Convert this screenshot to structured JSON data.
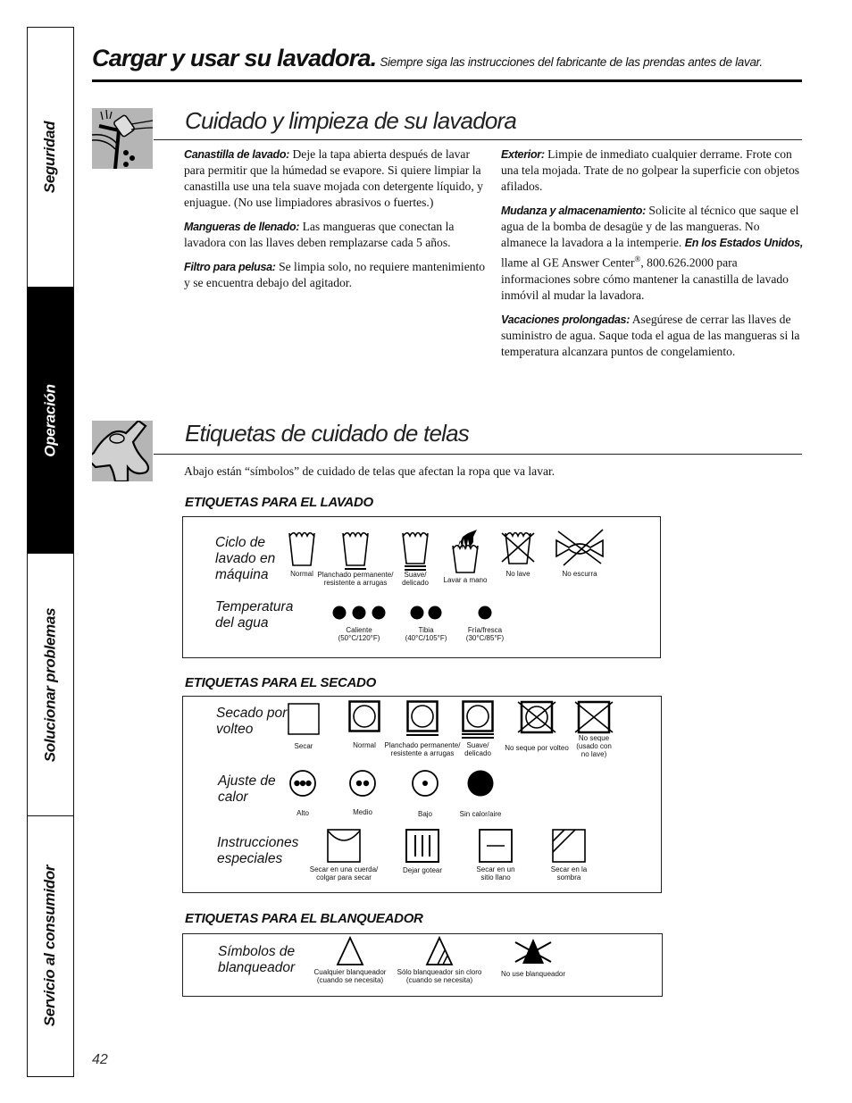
{
  "side_tabs": [
    {
      "label": "Seguridad",
      "active": false
    },
    {
      "label": "Operación",
      "active": true
    },
    {
      "label": "Solucionar problemas",
      "active": false
    },
    {
      "label": "Servicio al consumidor",
      "active": false
    }
  ],
  "header": {
    "title": "Cargar y usar su lavadora.",
    "subtitle": "Siempre siga las instrucciones del fabricante de las prendas antes de lavar."
  },
  "care_section": {
    "icon": "washer-cleaning-sponge-icon",
    "title": "Cuidado y limpieza de su lavadora",
    "left": [
      {
        "term": "Canastilla de lavado:",
        "text": "Deje la tapa abierta después de lavar para permitir que la húmedad se evapore. Si quiere limpiar la canastilla use una tela suave mojada con detergente líquido, y enjuague. (No use limpiadores abrasivos o fuertes.)"
      },
      {
        "term": "Mangueras de llenado:",
        "text": "Las mangueras que conectan la lavadora con las llaves deben remplazarse cada 5 años."
      },
      {
        "term": "Filtro para pelusa:",
        "text": "Se limpia solo, no requiere mantenimiento y se encuentra debajo del agitador."
      }
    ],
    "right": [
      {
        "term": "Exterior:",
        "text": "Limpie de inmediato cualquier derrame. Frote con una tela mojada. Trate de no golpear la superficie con objetos afilados."
      },
      {
        "term": "Mudanza y almacenamiento:",
        "text": "Solicite al técnico que saque el agua de la bomba de desagüe y de las mangueras. No almanece la lavadora a la intemperie.",
        "term2": "En los Estados Unidos,",
        "text2": "llame al GE Answer Center",
        "reg": "®",
        "text3": ", 800.626.2000 para informaciones sobre cómo mantener la canastilla de lavado inmóvil al mudar la lavadora."
      },
      {
        "term": "Vacaciones prolongadas:",
        "text": "Asegúrese de cerrar las llaves de suministro de agua. Saque toda el agua de las mangueras si la temperatura alcanzara puntos de congelamiento."
      }
    ]
  },
  "fabric_section": {
    "icon": "shirt-icon",
    "title": "Etiquetas de cuidado de telas",
    "intro": "Abajo están “símbolos” de cuidado de telas que afectan la ropa que va lavar.",
    "washing": {
      "heading": "ETIQUETAS PARA EL LAVADO",
      "cycle_label": "Ciclo de lavado en máquina",
      "cycle": [
        {
          "icon": "wash-tub-icon",
          "caption": "Normal"
        },
        {
          "icon": "wash-tub-one-bar-icon",
          "caption": "Planchado permanente/\nresistente a arrugas"
        },
        {
          "icon": "wash-tub-two-bars-icon",
          "caption": "Suave/\ndelicado"
        },
        {
          "icon": "hand-wash-icon",
          "caption": "Lavar a mano"
        },
        {
          "icon": "do-not-wash-icon",
          "caption": "No lave"
        },
        {
          "icon": "do-not-wring-icon",
          "caption": "No escurra"
        }
      ],
      "temp_label": "Temperatura del agua",
      "temps": [
        {
          "icon": "three-dots-icon",
          "caption": "Caliente\n(50°C/120°F)"
        },
        {
          "icon": "two-dots-icon",
          "caption": "Tibia\n(40°C/105°F)"
        },
        {
          "icon": "one-dot-icon",
          "caption": "Fría/fresca\n(30°C/85°F)"
        }
      ]
    },
    "drying": {
      "heading": "ETIQUETAS PARA EL SECADO",
      "tumble_label": "Secado por volteo",
      "tumble": [
        {
          "icon": "dry-square-icon",
          "caption": "Secar"
        },
        {
          "icon": "tumble-dry-icon",
          "caption": "Normal"
        },
        {
          "icon": "tumble-dry-one-bar-icon",
          "caption": "Planchado permanente/\nresistente a arrugas"
        },
        {
          "icon": "tumble-dry-two-bars-icon",
          "caption": "Suave/\ndelicado"
        },
        {
          "icon": "do-not-tumble-dry-icon",
          "caption": "No seque por volteo"
        },
        {
          "icon": "do-not-dry-icon",
          "caption": "No seque\n(usado con\nno lave)"
        }
      ],
      "heat_label": "Ajuste de calor",
      "heat": [
        {
          "icon": "heat-high-icon",
          "caption": "Alto"
        },
        {
          "icon": "heat-medium-icon",
          "caption": "Medio"
        },
        {
          "icon": "heat-low-icon",
          "caption": "Bajo"
        },
        {
          "icon": "no-heat-icon",
          "caption": "Sin calor/aire"
        }
      ],
      "special_label": "Instrucciones especiales",
      "special": [
        {
          "icon": "line-dry-icon",
          "caption": "Secar en una cuerda/\ncolgar para secar"
        },
        {
          "icon": "drip-dry-icon",
          "caption": "Dejar gotear"
        },
        {
          "icon": "dry-flat-icon",
          "caption": "Secar en un\nsitio llano"
        },
        {
          "icon": "dry-shade-icon",
          "caption": "Secar en la\nsombra"
        }
      ]
    },
    "bleach": {
      "heading": "ETIQUETAS PARA EL BLANQUEADOR",
      "label": "Símbolos de blanqueador",
      "items": [
        {
          "icon": "any-bleach-icon",
          "caption": "Cualquier blanqueador\n(cuando se necesita)"
        },
        {
          "icon": "non-chlorine-bleach-icon",
          "caption": "Sólo blanqueador sin cloro\n(cuando se necesita)"
        },
        {
          "icon": "do-not-bleach-icon",
          "caption": "No use blanqueador"
        }
      ]
    }
  },
  "page_number": "42"
}
